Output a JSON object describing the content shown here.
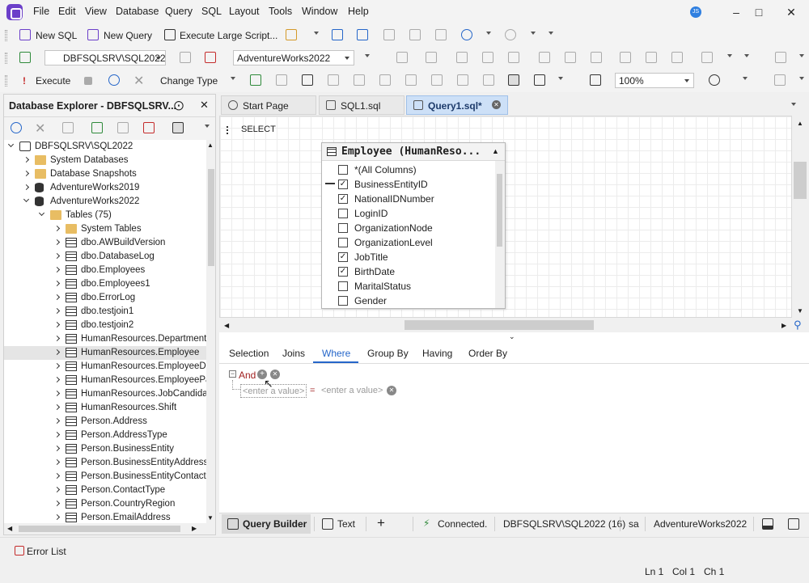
{
  "menu": [
    "File",
    "Edit",
    "View",
    "Database",
    "Query",
    "SQL",
    "Layout",
    "Tools",
    "Window",
    "Help"
  ],
  "user_initials": "JS",
  "toolbar1": {
    "new_sql": "New SQL",
    "new_query": "New Query",
    "execute_large_script": "Execute Large Script..."
  },
  "toolbar2": {
    "connection": "DBFSQLSRV\\SQL2022",
    "database": "AdventureWorks2022"
  },
  "toolbar3": {
    "execute": "Execute",
    "change_type": "Change Type",
    "zoom": "100%"
  },
  "explorer": {
    "title": "Database Explorer - DBFSQLSRV...",
    "tree": [
      {
        "label": "DBFSQLSRV\\SQL2022",
        "level": 0,
        "icon": "server",
        "state": "down"
      },
      {
        "label": "System Databases",
        "level": 1,
        "icon": "folder",
        "state": "right"
      },
      {
        "label": "Database Snapshots",
        "level": 1,
        "icon": "folder",
        "state": "right"
      },
      {
        "label": "AdventureWorks2019",
        "level": 1,
        "icon": "db",
        "state": "right"
      },
      {
        "label": "AdventureWorks2022",
        "level": 1,
        "icon": "db",
        "state": "down"
      },
      {
        "label": "Tables (75)",
        "level": 2,
        "icon": "folder",
        "state": "down"
      },
      {
        "label": "System Tables",
        "level": 3,
        "icon": "folder",
        "state": "right"
      },
      {
        "label": "dbo.AWBuildVersion",
        "level": 3,
        "icon": "table",
        "state": "right"
      },
      {
        "label": "dbo.DatabaseLog",
        "level": 3,
        "icon": "table",
        "state": "right"
      },
      {
        "label": "dbo.Employees",
        "level": 3,
        "icon": "table",
        "state": "right"
      },
      {
        "label": "dbo.Employees1",
        "level": 3,
        "icon": "table",
        "state": "right"
      },
      {
        "label": "dbo.ErrorLog",
        "level": 3,
        "icon": "table",
        "state": "right"
      },
      {
        "label": "dbo.testjoin1",
        "level": 3,
        "icon": "table",
        "state": "right"
      },
      {
        "label": "dbo.testjoin2",
        "level": 3,
        "icon": "table",
        "state": "right"
      },
      {
        "label": "HumanResources.Department",
        "level": 3,
        "icon": "table",
        "state": "right"
      },
      {
        "label": "HumanResources.Employee",
        "level": 3,
        "icon": "table",
        "state": "right",
        "selected": true
      },
      {
        "label": "HumanResources.EmployeeDepartmentHistory",
        "level": 3,
        "icon": "table",
        "state": "right"
      },
      {
        "label": "HumanResources.EmployeePayHistory",
        "level": 3,
        "icon": "table",
        "state": "right"
      },
      {
        "label": "HumanResources.JobCandidate",
        "level": 3,
        "icon": "table",
        "state": "right"
      },
      {
        "label": "HumanResources.Shift",
        "level": 3,
        "icon": "table",
        "state": "right"
      },
      {
        "label": "Person.Address",
        "level": 3,
        "icon": "table",
        "state": "right"
      },
      {
        "label": "Person.AddressType",
        "level": 3,
        "icon": "table",
        "state": "right"
      },
      {
        "label": "Person.BusinessEntity",
        "level": 3,
        "icon": "table",
        "state": "right"
      },
      {
        "label": "Person.BusinessEntityAddress",
        "level": 3,
        "icon": "table",
        "state": "right"
      },
      {
        "label": "Person.BusinessEntityContact",
        "level": 3,
        "icon": "table",
        "state": "right"
      },
      {
        "label": "Person.ContactType",
        "level": 3,
        "icon": "table",
        "state": "right"
      },
      {
        "label": "Person.CountryRegion",
        "level": 3,
        "icon": "table",
        "state": "right"
      },
      {
        "label": "Person.EmailAddress",
        "level": 3,
        "icon": "table",
        "state": "right"
      }
    ]
  },
  "doc_tabs": [
    {
      "label": "Start Page",
      "active": false
    },
    {
      "label": "SQL1.sql",
      "active": false
    },
    {
      "label": "Query1.sql*",
      "active": true
    }
  ],
  "diagram": {
    "select_label": "SELECT",
    "table_title": "Employee (HumanReso...",
    "columns": [
      {
        "name": "*(All Columns)",
        "checked": false,
        "key": false
      },
      {
        "name": "BusinessEntityID",
        "checked": true,
        "key": true
      },
      {
        "name": "NationalIDNumber",
        "checked": true,
        "key": false
      },
      {
        "name": "LoginID",
        "checked": false,
        "key": false
      },
      {
        "name": "OrganizationNode",
        "checked": false,
        "key": false
      },
      {
        "name": "OrganizationLevel",
        "checked": false,
        "key": false
      },
      {
        "name": "JobTitle",
        "checked": true,
        "key": false
      },
      {
        "name": "BirthDate",
        "checked": true,
        "key": false
      },
      {
        "name": "MaritalStatus",
        "checked": false,
        "key": false
      },
      {
        "name": "Gender",
        "checked": false,
        "key": false
      }
    ]
  },
  "sub_tabs": [
    "Selection",
    "Joins",
    "Where",
    "Group By",
    "Having",
    "Order By"
  ],
  "active_sub_tab": "Where",
  "where": {
    "operator": "And",
    "left_placeholder": "<enter a value>",
    "eq": "=",
    "right_placeholder": "<enter a value>"
  },
  "editor_status": {
    "query_builder": "Query Builder",
    "text": "Text",
    "connected": "Connected.",
    "server": "DBFSQLSRV\\SQL2022 (16)",
    "user": "sa",
    "database": "AdventureWorks2022"
  },
  "bottom": {
    "error_list": "Error List"
  },
  "statusbar": {
    "ln": "Ln 1",
    "col": "Col 1",
    "ch": "Ch 1"
  }
}
